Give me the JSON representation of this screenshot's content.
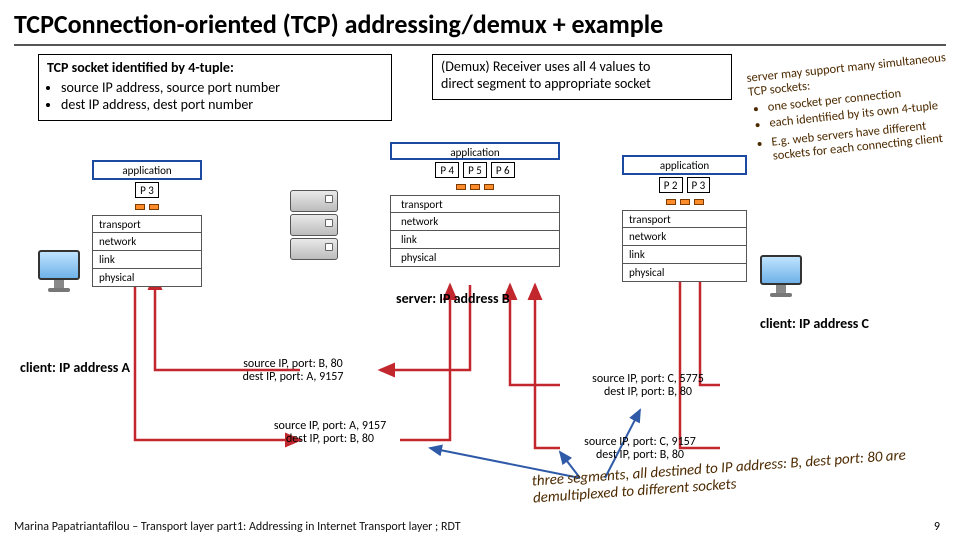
{
  "title": "TCPConnection-oriented (TCP) addressing/demux + example",
  "box_left": {
    "hdr": "TCP socket identified by 4-tuple:",
    "b1": "source IP address, source port number",
    "b2": "dest IP address, dest port number"
  },
  "box_right": {
    "l1": "(Demux) Receiver uses all 4 values to",
    "l2": "direct segment to appropriate socket"
  },
  "side": {
    "p1": "server may support many simultaneous TCP sockets:",
    "b1": "one socket per connection",
    "b2": "each identified by its own 4-tuple",
    "p2": "E.g. web servers have different sockets for each connecting client"
  },
  "stack_labels": {
    "application": "application",
    "transport": "transport",
    "network": "network",
    "link": "link",
    "physical": "physical"
  },
  "ports": {
    "P2": "P 2",
    "P3": "P 3",
    "P4": "P 4",
    "P5": "P 5",
    "P6": "P 6"
  },
  "labels": {
    "clientA": "client: IP address A",
    "clientC": "client: IP address C",
    "serverB": "server: IP address B"
  },
  "segs": {
    "s1a": "source IP, port: B, 80",
    "s1b": "dest IP, port: A, 9157",
    "s2a": "source IP, port: A, 9157",
    "s2b": "dest IP, port: B, 80",
    "s3a": "source IP, port: C, 5775",
    "s3b": "dest IP, port: B, 80",
    "s4a": "source IP, port: C, 9157",
    "s4b": "dest IP, port: B, 80"
  },
  "callout": "three segments, all destined to IP address: B, dest port: 80 are demultiplexed to different sockets",
  "footer": "Marina Papatriantafilou – Transport layer part1: Addressing in Internet Transport layer ; RDT",
  "pagenum": "9"
}
